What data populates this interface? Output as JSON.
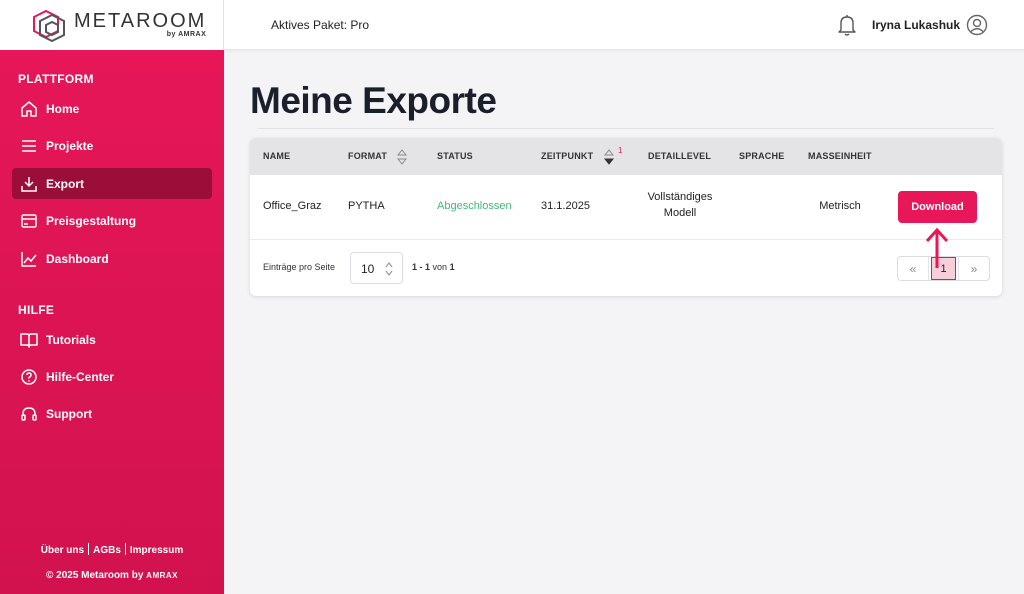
{
  "app": {
    "logo_name": "METAROOM",
    "logo_by": "by AMRAX",
    "package_label": "Aktives Paket: Pro",
    "user_name": "Iryna Lukashuk"
  },
  "sidebar": {
    "section_platform": "PLATTFORM",
    "platform_items": [
      {
        "label": "Home",
        "icon": "home-icon"
      },
      {
        "label": "Projekte",
        "icon": "list-icon"
      },
      {
        "label": "Export",
        "icon": "export-icon",
        "active": true
      },
      {
        "label": "Preisgestaltung",
        "icon": "card-icon"
      },
      {
        "label": "Dashboard",
        "icon": "chart-icon"
      }
    ],
    "section_help": "HILFE",
    "help_items": [
      {
        "label": "Tutorials",
        "icon": "book-icon"
      },
      {
        "label": "Hilfe-Center",
        "icon": "help-icon"
      },
      {
        "label": "Support",
        "icon": "headset-icon"
      }
    ],
    "footer_links": [
      "Über uns",
      "AGBs",
      "Impressum"
    ],
    "copyright": "© 2025 Metaroom by",
    "copyright_brand": "AMRAX"
  },
  "main": {
    "title": "Meine Exporte",
    "table": {
      "headers": [
        "NAME",
        "FORMAT",
        "STATUS",
        "ZEITPUNKT",
        "DETAILLEVEL",
        "SPRACHE",
        "MASSEINHEIT"
      ],
      "sort_count": "1",
      "rows": [
        {
          "name": "Office_Graz",
          "format": "PYTHA",
          "status": "Abgeschlossen",
          "timestamp": "31.1.2025",
          "detail_line1": "Vollständiges",
          "detail_line2": "Modell",
          "language": "",
          "unit": "Metrisch",
          "action": "Download"
        }
      ]
    },
    "pagination": {
      "per_page_label": "Einträge pro Seite",
      "per_page_value": "10",
      "range_from_to": "1 - 1",
      "range_of": "von",
      "range_total": "1",
      "prev": "«",
      "current_page": "1",
      "next": "»"
    }
  },
  "colors": {
    "accent": "#e8175a",
    "sidebar_active": "#9c0e3a",
    "status_done": "#3fb979"
  }
}
